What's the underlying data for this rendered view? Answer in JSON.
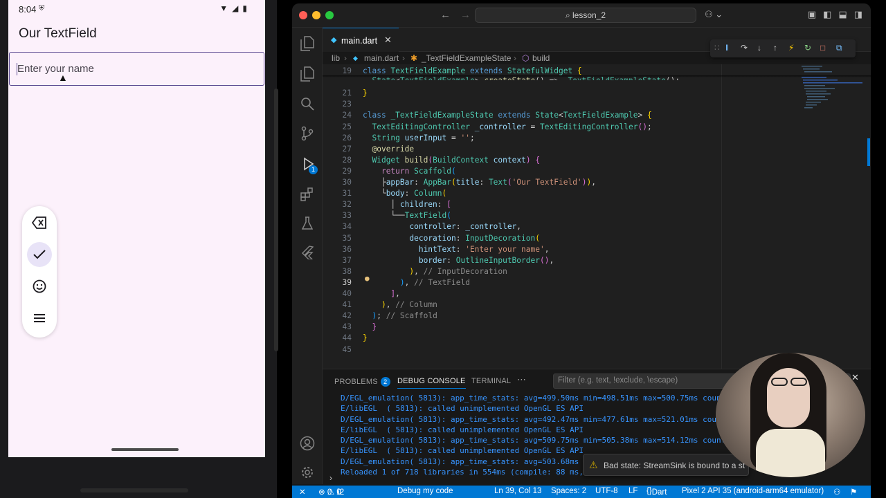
{
  "phone": {
    "status_time": "8:04",
    "app_title": "Our TextField",
    "text_field_hint": "Enter your name",
    "toolbar_icons": [
      "backspace-icon",
      "check-icon",
      "emoji-icon",
      "menu-icon"
    ]
  },
  "vscode": {
    "command_center": "lesson_2",
    "tab_label": "main.dart",
    "breadcrumb": [
      "lib",
      "main.dart",
      "_TextFieldExampleState",
      "build"
    ],
    "editor": {
      "active_line": 39,
      "lines": [
        {
          "n": "19",
          "html": "<span class='kw'>class</span> <span class='ty'>TextFieldExample</span> <span class='kw'>extends</span> <span class='ty'>StatefulWidget</span> <span class='br1'>{</span>"
        },
        {
          "n": "21",
          "html": "<span class='br1'>}</span>"
        },
        {
          "n": "23",
          "html": ""
        },
        {
          "n": "24",
          "html": "<span class='kw'>class</span> <span class='ty'>_TextFieldExampleState</span> <span class='kw'>extends</span> <span class='ty'>State</span><span class='pun'>&lt;</span><span class='ty'>TextFieldExample</span><span class='pun'>&gt;</span> <span class='br1'>{</span>"
        },
        {
          "n": "25",
          "html": "  <span class='ty'>TextEditingController</span> <span class='id'>_controller</span> = <span class='ty'>TextEditingController</span><span class='br2'>()</span>;"
        },
        {
          "n": "26",
          "html": "  <span class='ty'>String</span> <span class='id'>userInput</span> = <span class='str'>''</span>;"
        },
        {
          "n": "27",
          "html": "  <span class='fn'>@override</span>"
        },
        {
          "n": "28",
          "html": "  <span class='ty'>Widget</span> <span class='fn'>build</span><span class='br2'>(</span><span class='ty'>BuildContext</span> <span class='id'>context</span><span class='br2'>)</span> <span class='br2'>{</span>"
        },
        {
          "n": "29",
          "html": "    <span class='kw2'>return</span> <span class='ty'>Scaffold</span><span class='br3'>(</span>"
        },
        {
          "n": "30",
          "html": "    ├<span class='id'>appBar</span>: <span class='ty'>AppBar</span><span class='br1'>(</span><span class='id'>title</span>: <span class='ty'>Text</span><span class='br2'>(</span><span class='str'>'Our TextField'</span><span class='br2'>)</span><span class='br1'>)</span>,"
        },
        {
          "n": "31",
          "html": "    └<span class='id'>body</span>: <span class='ty'>Column</span><span class='br1'>(</span>"
        },
        {
          "n": "32",
          "html": "      │ <span class='id'>children</span>: <span class='br2'>[</span>"
        },
        {
          "n": "33",
          "html": "      └──<span class='ty'>TextField</span><span class='br3'>(</span>"
        },
        {
          "n": "34",
          "html": "          <span class='id'>controller</span>: <span class='id'>_controller</span>,"
        },
        {
          "n": "35",
          "html": "          <span class='id'>decoration</span>: <span class='ty'>InputDecoration</span><span class='br1'>(</span>"
        },
        {
          "n": "36",
          "html": "            <span class='id'>hintText</span>: <span class='str'>'Enter your name'</span>,"
        },
        {
          "n": "37",
          "html": "            <span class='id'>border</span>: <span class='ty'>OutlineInputBorder</span><span class='br2'>()</span>,"
        },
        {
          "n": "38",
          "html": "          <span class='br1'>)</span>, <span class='cm'>// InputDecoration</span>"
        },
        {
          "n": "39",
          "html": "        <span class='br3'>)</span>, <span class='cm'>// TextField</span>"
        },
        {
          "n": "40",
          "html": "      <span class='br2'>]</span>,"
        },
        {
          "n": "41",
          "html": "    <span class='br1'>)</span>, <span class='cm'>// Column</span>"
        },
        {
          "n": "42",
          "html": "  <span class='br3'>)</span>; <span class='cm'>// Scaffold</span>"
        },
        {
          "n": "43",
          "html": "  <span class='br2'>}</span>"
        },
        {
          "n": "44",
          "html": "<span class='br1'>}</span>"
        },
        {
          "n": "45",
          "html": ""
        }
      ],
      "sticky_line": {
        "n": "20",
        "html": "  <span class='ty'>State</span>&lt;<span class='ty'>TextFieldExample</span>&gt; <span class='fn'>createState</span>() =&gt; <span class='ty'>_TextFieldExampleState</span>();"
      }
    },
    "panel": {
      "tabs": [
        "PROBLEMS",
        "DEBUG CONSOLE",
        "TERMINAL"
      ],
      "problems_count": "2",
      "filter_placeholder": "Filter (e.g. text, !exclude, \\escape)",
      "console_lines": [
        "D/EGL_emulation( 5813): app_time_stats: avg=499.50ms min=498.51ms max=500.75ms count=",
        "E/libEGL  ( 5813): called unimplemented OpenGL ES API",
        "D/EGL_emulation( 5813): app_time_stats: avg=492.47ms min=477.61ms max=521.01ms count",
        "E/libEGL  ( 5813): called unimplemented OpenGL ES API",
        "D/EGL_emulation( 5813): app_time_stats: avg=509.75ms min=505.38ms max=514.12ms count=",
        "E/libEGL  ( 5813): called unimplemented OpenGL ES API",
        "D/EGL_emulation( 5813): app_time_stats: avg=503.68ms mi",
        "Reloaded 1 of 718 libraries in 554ms (compile: 88 ms, "
      ]
    },
    "notification": "Bad state: StreamSink is bound to a st",
    "statusbar": {
      "errors": "0",
      "warnings": "0",
      "info": "2",
      "debug_label": "Debug my code",
      "position": "Ln 39, Col 13",
      "spaces": "Spaces: 2",
      "encoding": "UTF-8",
      "eol": "LF",
      "language": "Dart",
      "device": "Pixel 2 API 35 (android-arm64 emulator)"
    }
  },
  "colors": {
    "accent": "#0078d4",
    "phone_bg": "#fcf1fb",
    "field_border": "#5b4b92"
  }
}
